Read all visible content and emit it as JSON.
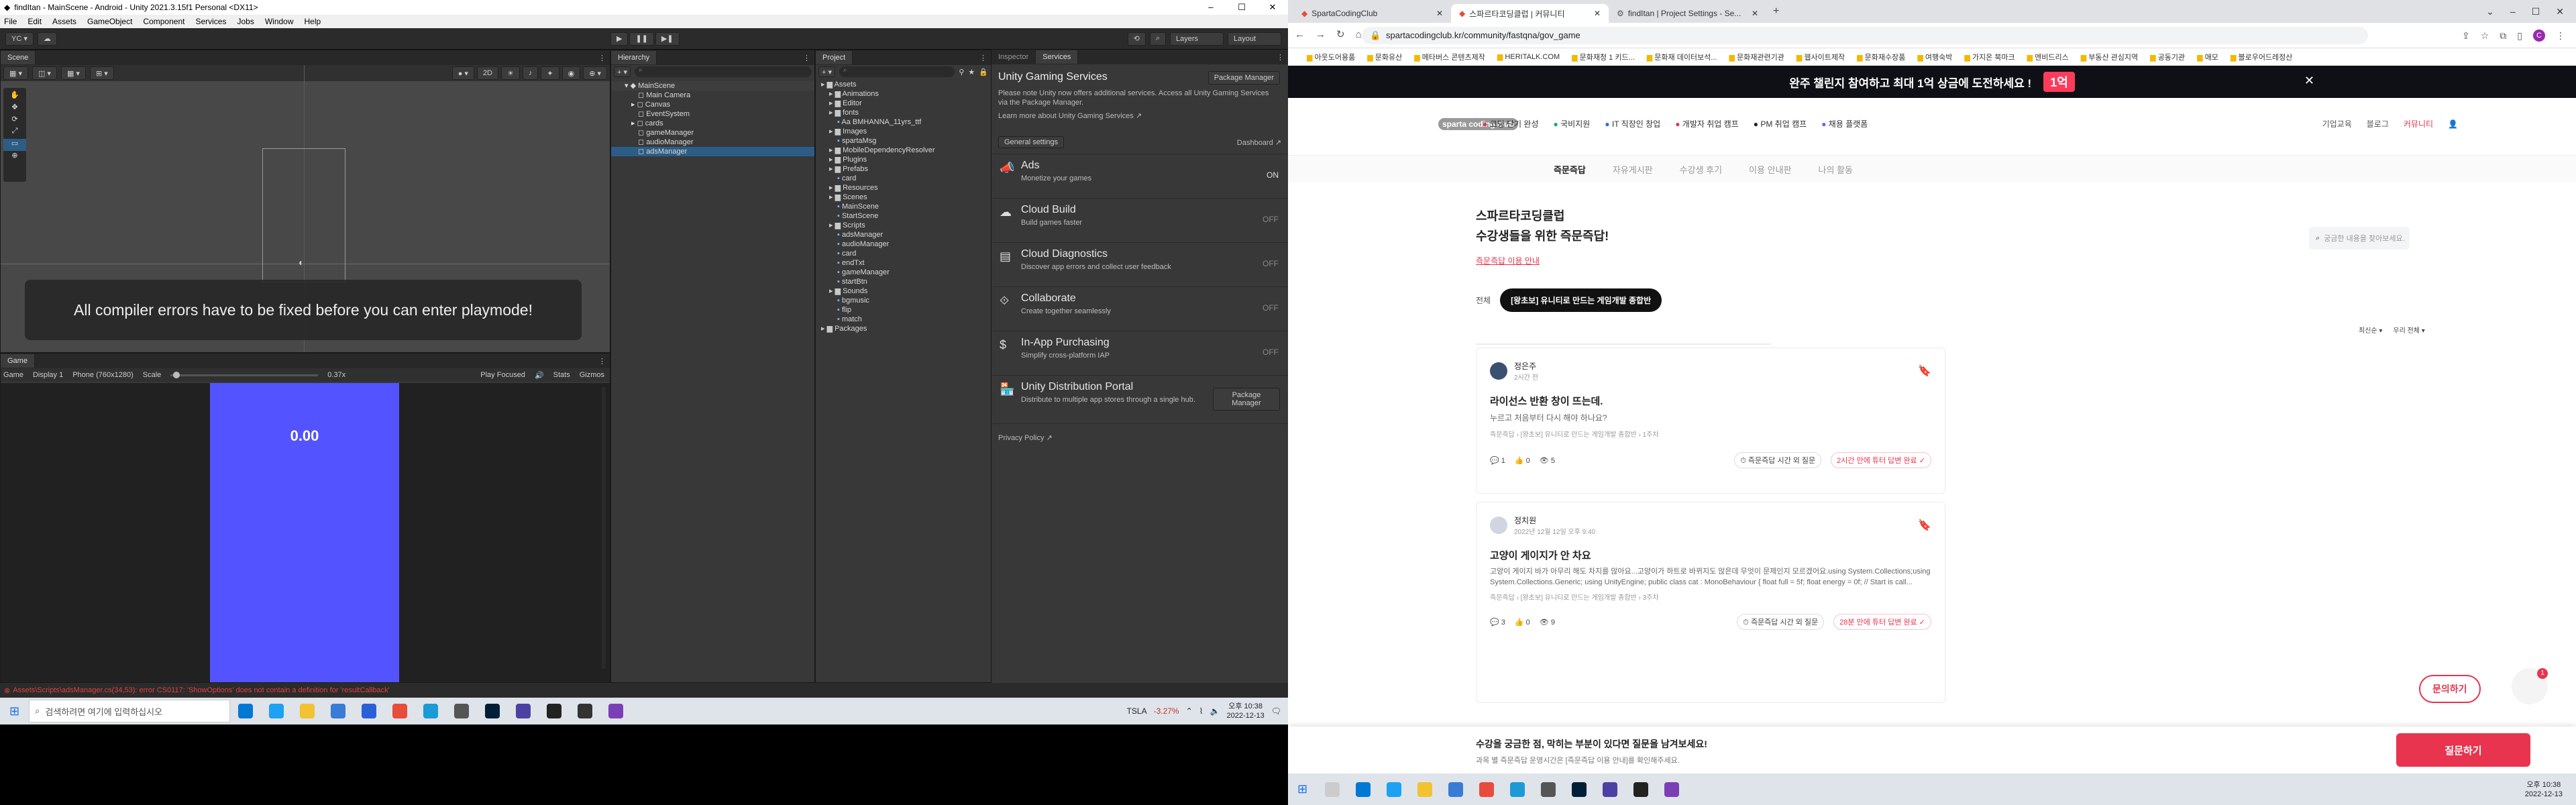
{
  "unity": {
    "title": "findItan - MainScene - Android - Unity 2021.3.15f1 Personal <DX11>",
    "menu": [
      "File",
      "Edit",
      "Assets",
      "GameObject",
      "Component",
      "Services",
      "Jobs",
      "Window",
      "Help"
    ],
    "toolbar": {
      "account": "YC ▾",
      "layers": "Layers",
      "layout": "Layout"
    },
    "scene": {
      "tab": "Scene",
      "error": "All compiler errors have to be fixed before you can enter playmode!",
      "persp_label": "2D"
    },
    "game": {
      "tab": "Game",
      "display": "Game",
      "display_n": "Display 1",
      "resolution": "Phone (760x1280)",
      "scale_label": "Scale",
      "scale_value": "0.37x",
      "play_focused": "Play Focused",
      "stats": "Stats",
      "gizmos": "Gizmos",
      "score": "0.00"
    },
    "hierarchy": {
      "tab": "Hierarchy",
      "items": [
        "MainScene",
        "Main Camera",
        "Canvas",
        "EventSystem",
        "cards",
        "gameManager",
        "audioManager",
        "adsManager"
      ]
    },
    "project": {
      "tab": "Project",
      "items": [
        "Assets",
        "Animations",
        "Editor",
        "fonts",
        "Aa BMHANNA_11yrs_ttf",
        "Images",
        "spartaMsg",
        "MobileDependencyResolver",
        "Plugins",
        "Prefabs",
        "card",
        "Resources",
        "Scenes",
        "MainScene",
        "StartScene",
        "Scripts",
        "adsManager",
        "audioManager",
        "card",
        "endTxt",
        "gameManager",
        "startBtn",
        "Sounds",
        "bgmusic",
        "flip",
        "match",
        "Packages"
      ]
    },
    "inspector": {
      "tab1": "Inspector",
      "tab2": "Services",
      "title": "Unity Gaming Services",
      "pkg_btn": "Package Manager",
      "desc": "Please note Unity now offers additional services. Access all Unity Gaming Services via the Package Manager.",
      "learn": "Learn more about Unity Gaming Services",
      "general": "General settings",
      "dashboard": "Dashboard",
      "services": [
        {
          "name": "Ads",
          "desc": "Monetize your games",
          "status": "ON"
        },
        {
          "name": "Cloud Build",
          "desc": "Build games faster",
          "status": "OFF"
        },
        {
          "name": "Cloud Diagnostics",
          "desc": "Discover app errors and collect user feedback",
          "status": "OFF"
        },
        {
          "name": "Collaborate",
          "desc": "Create together seamlessly",
          "status": "OFF"
        },
        {
          "name": "In-App Purchasing",
          "desc": "Simplify cross-platform IAP",
          "status": "OFF"
        },
        {
          "name": "Unity Distribution Portal",
          "desc": "Distribute to multiple app stores through a single hub.",
          "status": ""
        }
      ],
      "udp_btn": "Package Manager",
      "privacy": "Privacy Policy"
    },
    "status_error": "Assets\\Scripts\\adsManager.cs(34,53): error CS0117: 'ShowOptions' does not contain a definition for 'resultCallback'",
    "taskbar": {
      "search": "검색하려면 여기에 입력하십시오",
      "ticker": "TSLA",
      "change": "-3.27%",
      "time": "오후 10:38",
      "date": "2022-12-13"
    }
  },
  "chrome": {
    "tabs": [
      "SpartaCodingClub",
      "스파르타코딩클럽 | 커뮤니티",
      "findItan | Project Settings - Se..."
    ],
    "url": "spartacodingclub.kr/community/fastqna/gov_game",
    "bookmarks": [
      "아웃도어용품",
      "문화유산",
      "메타버스 콘텐츠제작",
      "HERITALK.COM",
      "문화재청 1 키드...",
      "문화재 데이터보석...",
      "문화재관련기관",
      "웹사이트제작",
      "문화재수장품",
      "여행숙박",
      "가지온 북마크",
      "엔비드리스",
      "부동산 관심지역",
      "공동기관",
      "애모",
      "블로우어드레정산"
    ],
    "banner": "완주 챌린지 참여하고 최대 1억 상금에 도전하세요 !",
    "banner_badge": "1억",
    "logo": "sparta coding club",
    "nav": [
      "코딩 단기 완성",
      "국비지원",
      "IT 직장인 창업",
      "개발자 취업 캠프",
      "PM 취업 캠프",
      "채용 플랫폼"
    ],
    "nav_right": [
      "기업교육",
      "블로그",
      "커뮤니티"
    ],
    "subnav": [
      "즉문즉답",
      "자유게시판",
      "수강생 후기",
      "이용 안내판",
      "나의 활동"
    ],
    "heading1": "스파르타코딩클럽",
    "heading2": "수강생들을 위한 즉문즉답!",
    "guide_link": "즉문즉답 이용 안내",
    "search_placeholder": "궁금한 내용을 찾아보세요.",
    "filters": [
      "전체",
      "[왕초보] 유니티로 만드는 게임개발 종합반"
    ],
    "sort": "최신순 ▾",
    "sort2": "우리 전체 ▾",
    "posts": [
      {
        "author": "정은주",
        "time": "2시간 전",
        "title": "라이선스 반환 창이 뜨는데.",
        "body": "누르고 처음부터 다시 해야 하나요?",
        "tags": "즉문즉답 › [왕초보] 유니티로 만드는 게임개발 종합반 › 1주차",
        "comments": "1",
        "likes": "0",
        "views": "5",
        "label1": "즉문즉답 시간 외 질문",
        "label2": "2시간 만에 튜터 답변 완료 ✓"
      },
      {
        "author": "정치원",
        "time": "2022년 12월 12일 오후 9:40",
        "title": "고양이 게이지가 안 차요",
        "body": "고양이 게이지 바가 아무리 해도 차지를 않아요...고양이가 하트로 바뀌지도 않은데 무엇이 문제인지 모르겠어요.using System.Collections;using System.Collections.Generic; using UnityEngine; public class cat : MonoBehaviour { float full = 5f; float energy = 0f; // Start is call...",
        "tags": "즉문즉답 › [왕초보] 유니티로 만드는 게임개발 종합반 › 3주차",
        "comments": "3",
        "likes": "0",
        "views": "9",
        "label1": "즉문즉답 시간 외 질문",
        "label2": "28분 만에 튜터 답변 완료 ✓"
      }
    ],
    "chat_btn": "문의하기",
    "chat_badge": "1",
    "bottom_title": "수강을 궁금한 점, 막히는 부분이 있다면 질문을 남겨보세요!",
    "bottom_sub": "과목 별 즉문즉답 운영시간은 [즉문즉답 이용 안내]를 확인해주세요.",
    "ask_btn": "질문하기",
    "taskbar": {
      "time": "오후 10:38",
      "date": "2022-12-13"
    }
  }
}
